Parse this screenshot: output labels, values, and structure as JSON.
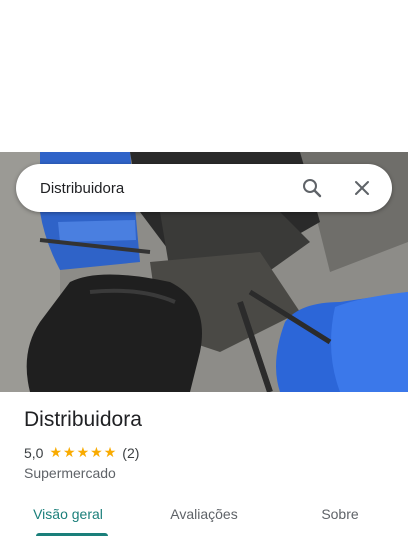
{
  "search": {
    "query": "Distribuidora"
  },
  "place": {
    "name": "Distribuidora",
    "rating": "5,0",
    "stars": 5,
    "review_count": "(2)",
    "category": "Supermercado"
  },
  "tabs": [
    {
      "label": "Visão geral",
      "active": true
    },
    {
      "label": "Avaliações",
      "active": false
    },
    {
      "label": "Sobre",
      "active": false
    }
  ],
  "colors": {
    "accent": "#1a7f7a",
    "star": "#f9ab00"
  },
  "icons": {
    "search": "search-icon",
    "close": "close-icon"
  }
}
